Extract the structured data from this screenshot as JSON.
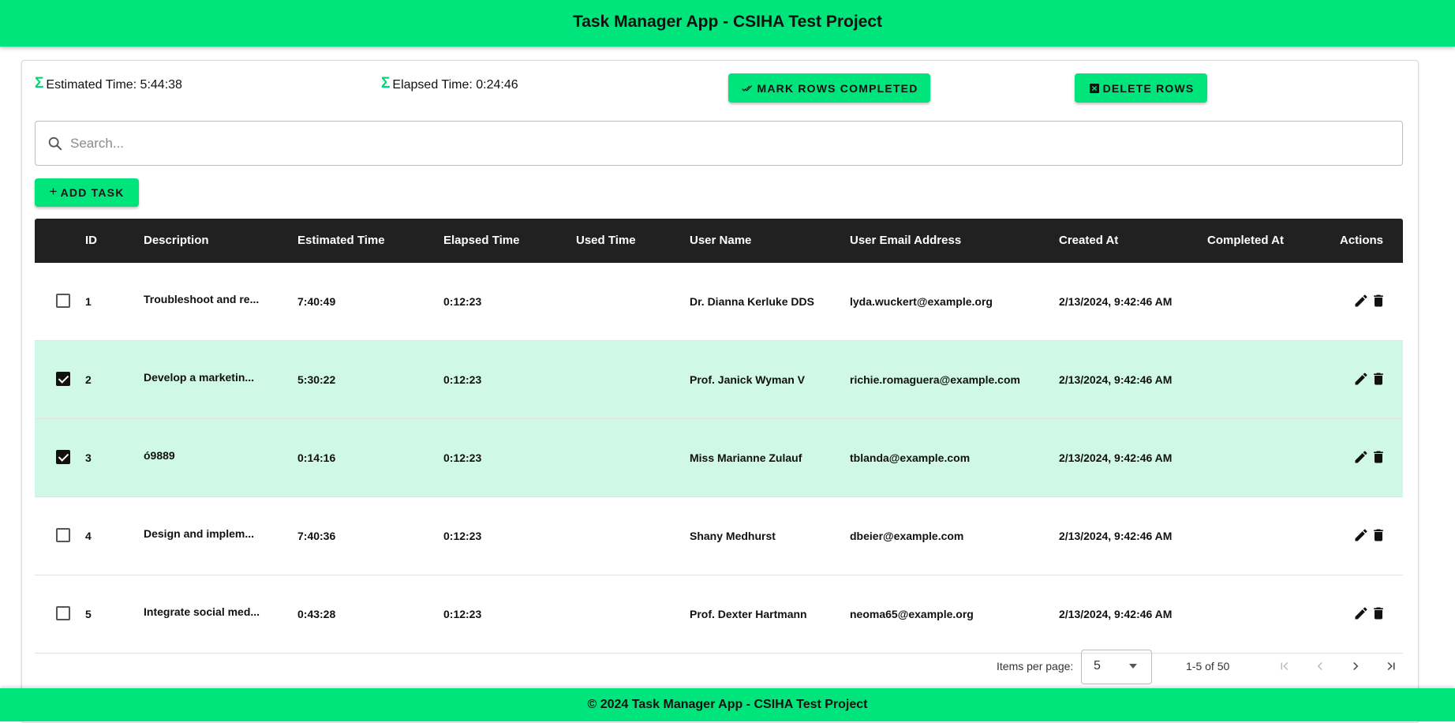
{
  "header": {
    "title": "Task Manager App - CSIHA Test Project"
  },
  "summary": {
    "estimated_label": "Estimated Time: 5:44:38",
    "elapsed_label": "Elapsed Time: 0:24:46",
    "sigma": "Σ"
  },
  "actions": {
    "mark_completed": "MARK ROWS COMPLETED",
    "delete_rows": "DELETE ROWS",
    "add_task": "ADD TASK"
  },
  "search": {
    "placeholder": "Search..."
  },
  "table": {
    "columns": [
      "ID",
      "Description",
      "Estimated Time",
      "Elapsed Time",
      "Used Time",
      "User Name",
      "User Email Address",
      "Created At",
      "Completed At",
      "Actions"
    ],
    "rows": [
      {
        "selected": false,
        "id": "1",
        "description": "Troubleshoot and re...",
        "estimated": "7:40:49",
        "elapsed": "0:12:23",
        "used": "",
        "user": "Dr. Dianna Kerluke DDS",
        "email": "lyda.wuckert@example.org",
        "created": "2/13/2024, 9:42:46 AM",
        "completed": ""
      },
      {
        "selected": true,
        "id": "2",
        "description": "Develop a marketin...",
        "estimated": "5:30:22",
        "elapsed": "0:12:23",
        "used": "",
        "user": "Prof. Janick Wyman V",
        "email": "richie.romaguera@example.com",
        "created": "2/13/2024, 9:42:46 AM",
        "completed": ""
      },
      {
        "selected": true,
        "id": "3",
        "description": "ó9889",
        "estimated": "0:14:16",
        "elapsed": "0:12:23",
        "used": "",
        "user": "Miss Marianne Zulauf",
        "email": "tblanda@example.com",
        "created": "2/13/2024, 9:42:46 AM",
        "completed": ""
      },
      {
        "selected": false,
        "id": "4",
        "description": "Design and implem...",
        "estimated": "7:40:36",
        "elapsed": "0:12:23",
        "used": "",
        "user": "Shany Medhurst",
        "email": "dbeier@example.com",
        "created": "2/13/2024, 9:42:46 AM",
        "completed": ""
      },
      {
        "selected": false,
        "id": "5",
        "description": "Integrate social med...",
        "estimated": "0:43:28",
        "elapsed": "0:12:23",
        "used": "",
        "user": "Prof. Dexter Hartmann",
        "email": "neoma65@example.org",
        "created": "2/13/2024, 9:42:46 AM",
        "completed": ""
      }
    ]
  },
  "paginator": {
    "items_per_page_label": "Items per page:",
    "page_size": "5",
    "range": "1-5 of 50"
  },
  "footer": {
    "text": "© 2024 Task Manager App - CSIHA Test Project"
  },
  "colors": {
    "accent": "#00e47c",
    "selected_row": "#d0f8e6",
    "table_header": "#212121"
  }
}
